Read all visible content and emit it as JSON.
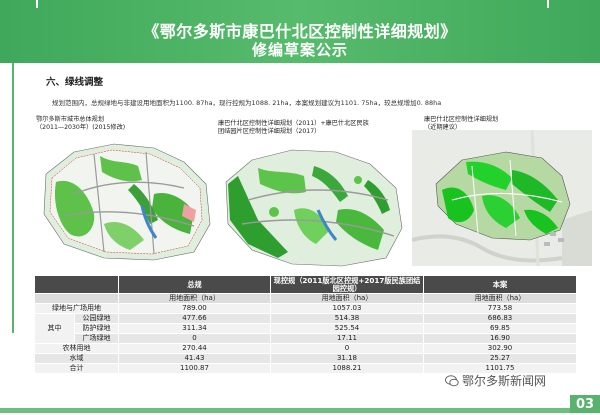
{
  "header": {
    "title_line1": "《鄂尔多斯市康巴什北区控制性详细规划》",
    "title_line2": "修编草案公示"
  },
  "section": {
    "heading": "六、绿线调整",
    "description": "规划范围内，总规绿地与非建设用地面积为1100. 87ha，现行控规为1088. 21ha，本案规划建议为1101. 75ha，较总规增加0. 88ha"
  },
  "maps": [
    {
      "caption_line1": "鄂尔多斯市城市总体规划",
      "caption_line2": "（2011—2030年）(2015修改)"
    },
    {
      "caption_line1": "康巴什北区控制性详细规划（2011）+康巴什北区民族",
      "caption_line2": "团结园片区控制性详细规划（2017）"
    },
    {
      "caption_line1": "康巴什北区控制性详细规划",
      "caption_line2": "（近期建议）"
    }
  ],
  "table": {
    "col_headers": [
      "总规",
      "现控规（2011版北区控规+2017版民族团结园控规）",
      "本案"
    ],
    "unit_row": [
      "用地面积（ha）",
      "用地面积（ha）",
      "用地面积（ha）"
    ],
    "rows": [
      {
        "label": "绿地与广场用地",
        "values": [
          "789.00",
          "1057.03",
          "773.58"
        ]
      },
      {
        "group": "其中",
        "label": "公园绿地",
        "values": [
          "477.66",
          "514.38",
          "686.83"
        ]
      },
      {
        "label": "防护绿地",
        "values": [
          "311.34",
          "525.54",
          "69.85"
        ]
      },
      {
        "label": "广场绿地",
        "values": [
          "0",
          "17.11",
          "16.90"
        ]
      },
      {
        "label": "农林用地",
        "values": [
          "270.44",
          "0",
          "302.90"
        ]
      },
      {
        "label": "水域",
        "values": [
          "41.43",
          "31.18",
          "25.27"
        ]
      },
      {
        "label": "合计",
        "values": [
          "1100.87",
          "1088.21",
          "1101.75"
        ]
      }
    ]
  },
  "watermark": "鄂尔多斯新闻网",
  "page_number": "03",
  "colors": {
    "accent": "#4fb365",
    "table_header": "#4a4a4a"
  }
}
